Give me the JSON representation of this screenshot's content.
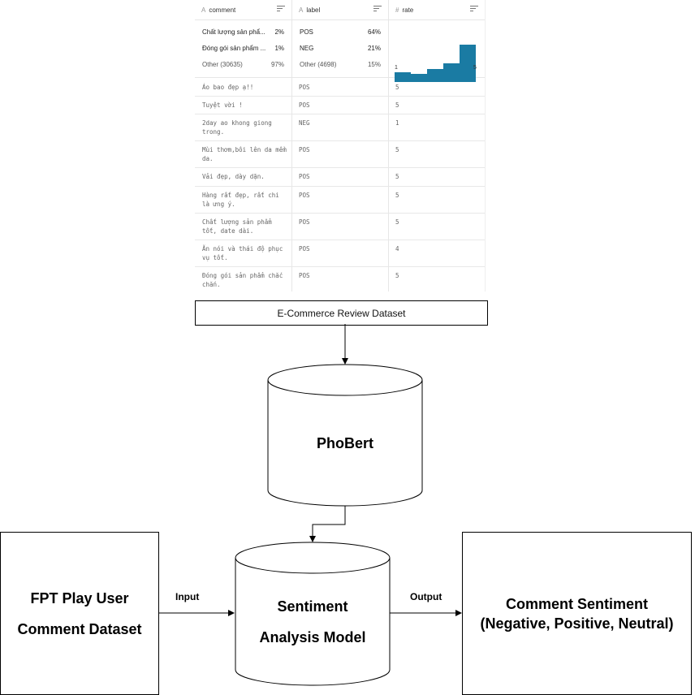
{
  "table": {
    "columns": [
      {
        "type_icon": "A",
        "name": "comment"
      },
      {
        "type_icon": "A",
        "name": "label"
      },
      {
        "type_icon": "#",
        "name": "rate"
      }
    ],
    "comment_summary": [
      {
        "name": "Chất lượng sản phẩ...",
        "pct": "2%"
      },
      {
        "name": "Đóng gói sản phẩm ...",
        "pct": "1%"
      },
      {
        "name": "Other (30635)",
        "pct": "97%"
      }
    ],
    "label_summary": [
      {
        "name": "POS",
        "pct": "64%"
      },
      {
        "name": "NEG",
        "pct": "21%"
      },
      {
        "name": "Other (4698)",
        "pct": "15%"
      }
    ],
    "rate_histogram": {
      "min_label": "1",
      "max_label": "5",
      "bar_heights": [
        0.25,
        0.22,
        0.34,
        0.5,
        1.0
      ]
    },
    "rows": [
      {
        "comment": "Áo bao đẹp ạ!!",
        "label": "POS",
        "rate": "5"
      },
      {
        "comment": "Tuyệt vời !",
        "label": "POS",
        "rate": "5"
      },
      {
        "comment": "2day ao khong giong trong.",
        "label": "NEG",
        "rate": "1"
      },
      {
        "comment": "Mùi thơm,bôi lên da mềm da.",
        "label": "POS",
        "rate": "5"
      },
      {
        "comment": "Vải đẹp, dày dặn.",
        "label": "POS",
        "rate": "5"
      },
      {
        "comment": "Hàng rất đẹp, rất chi là ưng ý.",
        "label": "POS",
        "rate": "5"
      },
      {
        "comment": "Chất lượng sản phẩm tốt, date dài.",
        "label": "POS",
        "rate": "5"
      },
      {
        "comment": "Ăn nói và thái độ phục vụ tốt.",
        "label": "POS",
        "rate": "4"
      },
      {
        "comment": "Đóng gói sản phẩm chắc chắn.",
        "label": "POS",
        "rate": "5"
      }
    ]
  },
  "diagram": {
    "ecommerce_dataset": "E-Commerce Review Dataset",
    "phobert": "PhoBert",
    "model_line1": "Sentiment",
    "model_line2": "Analysis Model",
    "input_dataset_line1": "FPT Play User",
    "input_dataset_line2": "Comment Dataset",
    "output_line1": "Comment Sentiment",
    "output_line2": "(Negative, Positive, Neutral)",
    "input_label": "Input",
    "output_label": "Output"
  },
  "colors": {
    "histogram_bar": "#1a7ba3",
    "border": "#000000"
  }
}
